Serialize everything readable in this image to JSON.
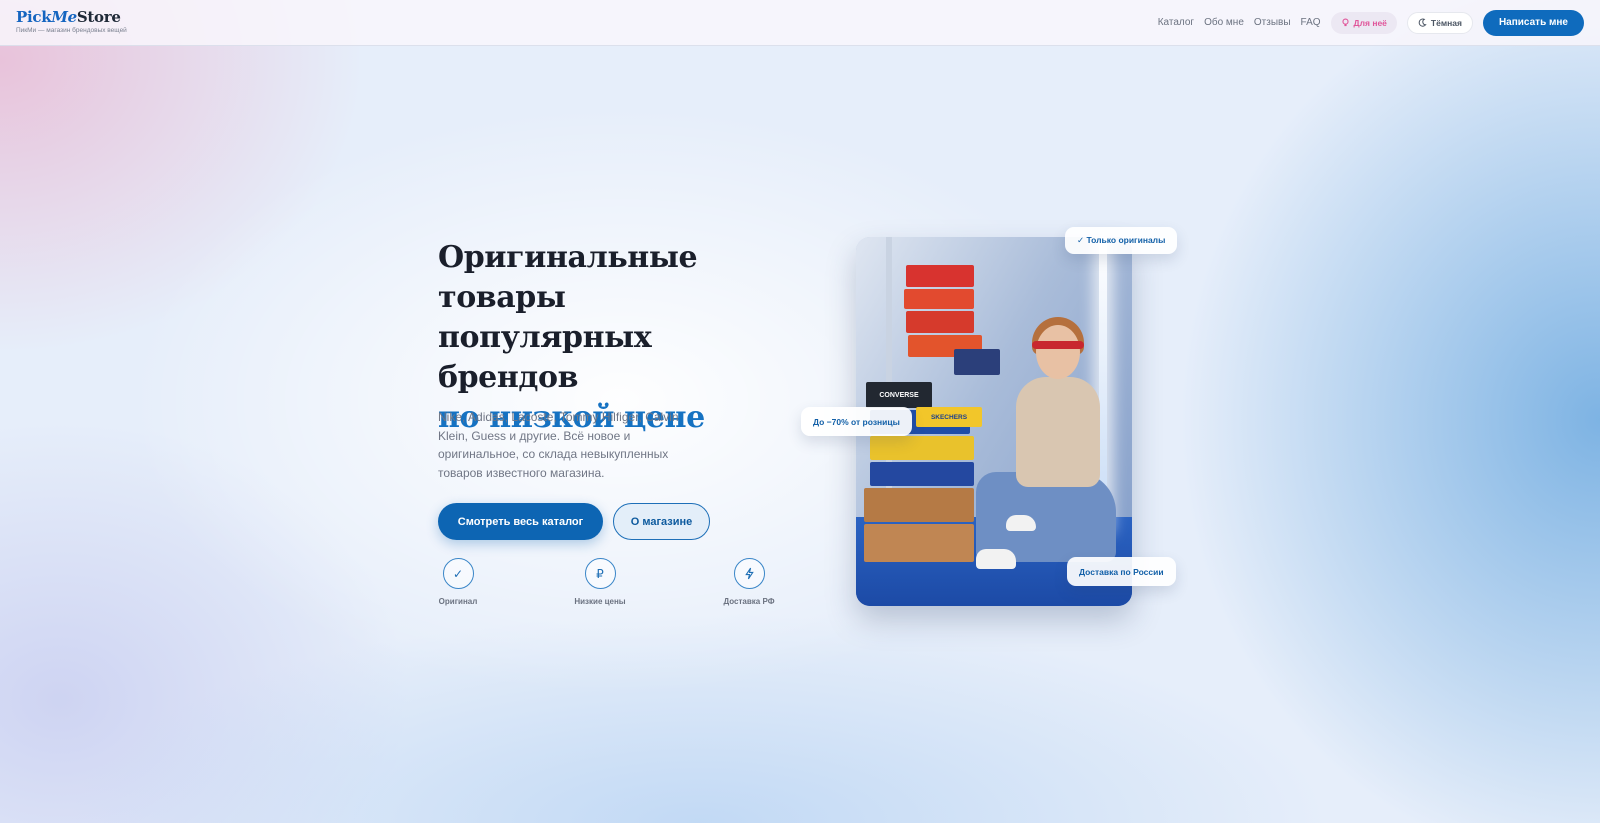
{
  "header": {
    "brand_pick": "Pick",
    "brand_me": "Me",
    "brand_store": "Store",
    "tagline": "ПикМи — магазин брендовых вещей",
    "nav": [
      "Каталог",
      "Обо мне",
      "Отзывы",
      "FAQ"
    ],
    "for_her": "Для неё",
    "dark_mode": "Тёмная",
    "cta": "Написать мне"
  },
  "hero": {
    "title_lines": [
      "Оригинальные",
      "товары популярных",
      "брендов"
    ],
    "title_accent": "по низкой цене",
    "description": "Nike, Adidas, Lacoste, Tommy Hilfiger, Calvin Klein, Guess и другие. Всё новое и оригинальное, со склада невыкупленных товаров известного магазина.",
    "primary_button": "Смотреть весь каталог",
    "secondary_button": "О магазине",
    "features": [
      {
        "icon": "check-icon",
        "glyph": "✓",
        "label": "Оригинал"
      },
      {
        "icon": "ruble-icon",
        "glyph": "₽",
        "label": "Низкие цены"
      },
      {
        "icon": "lightning-icon",
        "glyph": "ϟ",
        "label": "Доставка РФ"
      }
    ]
  },
  "photo": {
    "badge_originals": "✓ Только оригиналы",
    "badge_discount": "До −70% от розницы",
    "badge_delivery": "Доставка по России",
    "box_labels": [
      "CONVERSE",
      "SKECHERS"
    ]
  },
  "colors": {
    "accent": "#0f6bbd",
    "accent_text": "#1572c2",
    "pink": "#e0559a"
  }
}
